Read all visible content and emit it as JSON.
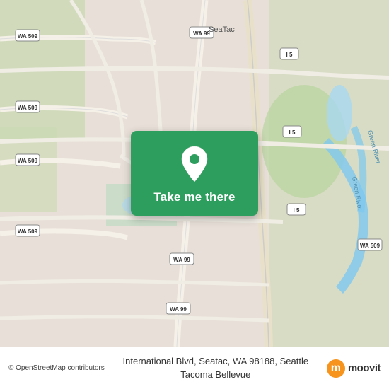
{
  "map": {
    "attribution": "© OpenStreetMap contributors",
    "background_color": "#e8e0d8"
  },
  "overlay": {
    "button_label": "Take me there",
    "pin_color": "#ffffff"
  },
  "bottom_bar": {
    "address": "International Blvd, Seatac, WA 98188, Seattle\nTacoma Bellevue",
    "osm_attribution": "© OpenStreetMap contributors",
    "moovit_m": "m",
    "moovit_label": "moovit"
  },
  "roads": [
    {
      "label": "WA 509",
      "instances": [
        "top-left-1",
        "mid-left-1",
        "mid-left-2",
        "bottom-left-1"
      ]
    },
    {
      "label": "WA 99",
      "instances": [
        "top-right-1",
        "mid-center-1",
        "bottom-center-1",
        "bottom-center-2"
      ]
    },
    {
      "label": "I 5",
      "instances": [
        "right-1",
        "right-2",
        "right-3"
      ]
    }
  ]
}
